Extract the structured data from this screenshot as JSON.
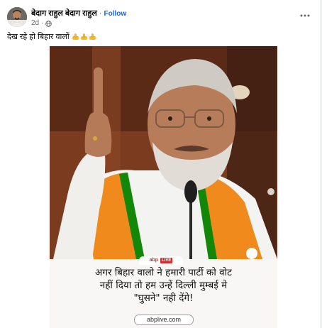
{
  "post": {
    "author_name": "बेदाग राहुल बेदाग राहुल",
    "separator": "·",
    "follow_label": "Follow",
    "timestamp": "2d",
    "meta_separator": "·",
    "privacy_icon": "globe-icon",
    "more_icon": "more-horizontal-icon",
    "text": "देख रहे हो बिहार वालों",
    "emojis": [
      "middle-finger-emoji",
      "middle-finger-emoji",
      "middle-finger-emoji"
    ]
  },
  "image": {
    "logo_brand": "abp",
    "logo_live": "LIVE",
    "caption_lines": [
      "अगर बिहार वालो ने हमारी पार्टी को वोट",
      "नहीं दिया तो हम उन्हें दिल्ली मुम्बई मे",
      "\"घुसने\" नही देंगे!"
    ],
    "url": "abplive.com"
  },
  "colors": {
    "link_blue": "#0866ff",
    "secondary_text": "#65676b",
    "saffron": "#f08a1c",
    "green": "#138808",
    "abp_red": "#d32f2f"
  }
}
